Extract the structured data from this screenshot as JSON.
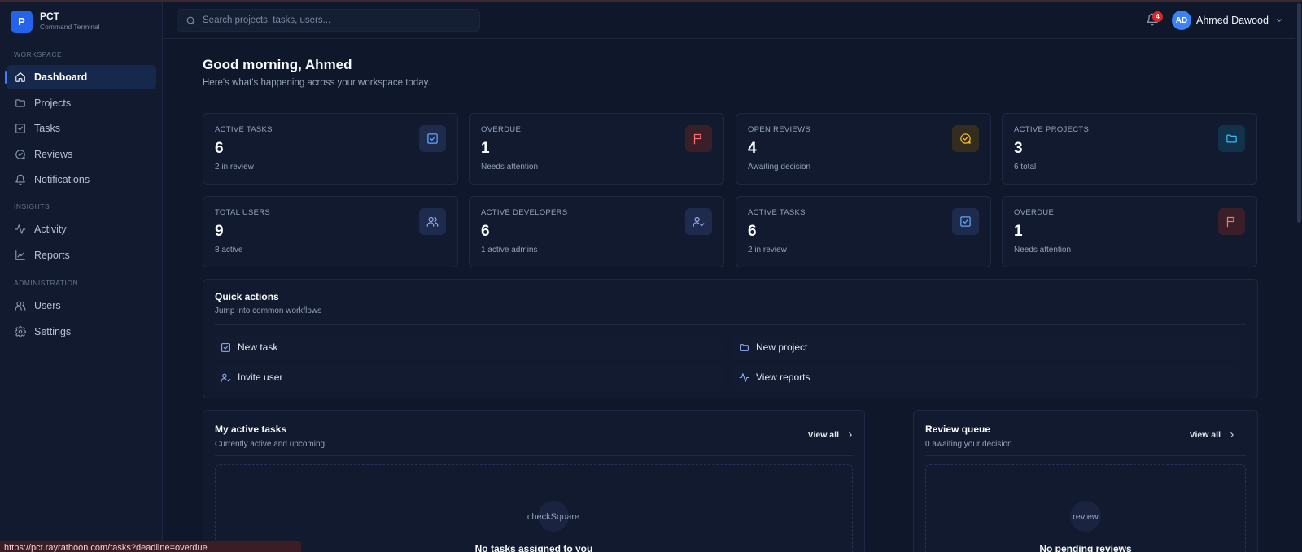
{
  "brand": {
    "logo_letter": "P",
    "name": "PCT",
    "subtitle": "Command Terminal"
  },
  "sidebar": {
    "sections": [
      {
        "title": "WORKSPACE",
        "items": [
          {
            "label": "Dashboard",
            "icon": "home-icon",
            "active": true
          },
          {
            "label": "Projects",
            "icon": "folder-icon"
          },
          {
            "label": "Tasks",
            "icon": "check-square-icon"
          },
          {
            "label": "Reviews",
            "icon": "message-circle-icon"
          },
          {
            "label": "Notifications",
            "icon": "bell-icon"
          }
        ]
      },
      {
        "title": "INSIGHTS",
        "items": [
          {
            "label": "Activity",
            "icon": "activity-icon"
          },
          {
            "label": "Reports",
            "icon": "line-chart-icon"
          }
        ]
      },
      {
        "title": "ADMINISTRATION",
        "items": [
          {
            "label": "Users",
            "icon": "users-icon"
          },
          {
            "label": "Settings",
            "icon": "gear-icon"
          }
        ]
      }
    ]
  },
  "header": {
    "search_placeholder": "Search projects, tasks, users...",
    "notification_count": "4",
    "user": {
      "initials": "AD",
      "name": "Ahmed Dawood"
    }
  },
  "main": {
    "greeting": "Good morning, Ahmed",
    "greeting_sub": "Here's what's happening across your workspace today.",
    "stats": [
      {
        "label": "ACTIVE TASKS",
        "value": "6",
        "sub": "2 in review",
        "icon": "check-square-icon",
        "color": "#60a5fa",
        "bg": "#1e2b4d"
      },
      {
        "label": "OVERDUE",
        "value": "1",
        "sub": "Needs attention",
        "icon": "flag-icon",
        "color": "#f87171",
        "bg": "#3a1e28"
      },
      {
        "label": "OPEN REVIEWS",
        "value": "4",
        "sub": "Awaiting decision",
        "icon": "message-circle-icon",
        "color": "#fbbf24",
        "bg": "#332c1f"
      },
      {
        "label": "ACTIVE PROJECTS",
        "value": "3",
        "sub": "6 total",
        "icon": "folder-icon",
        "color": "#38bdf8",
        "bg": "#12314a"
      },
      {
        "label": "TOTAL USERS",
        "value": "9",
        "sub": "8 active",
        "icon": "users-icon",
        "color": "#93a8e8",
        "bg": "#1e2b4d"
      },
      {
        "label": "ACTIVE DEVELOPERS",
        "value": "6",
        "sub": "1 active admins",
        "icon": "user-check-icon",
        "color": "#93a8e8",
        "bg": "#1e2b4d"
      },
      {
        "label": "ACTIVE TASKS",
        "value": "6",
        "sub": "2 in review",
        "icon": "check-square-icon",
        "color": "#60a5fa",
        "bg": "#1e2b4d"
      },
      {
        "label": "OVERDUE",
        "value": "1",
        "sub": "Needs attention",
        "icon": "flag-icon",
        "color": "#f87171",
        "bg": "#3a1e28"
      }
    ],
    "quick_actions": {
      "title": "Quick actions",
      "subtitle": "Jump into common workflows",
      "items": [
        {
          "label": "New task",
          "icon": "check-square-icon"
        },
        {
          "label": "New project",
          "icon": "folder-icon"
        },
        {
          "label": "Invite user",
          "icon": "user-check-icon"
        },
        {
          "label": "View reports",
          "icon": "activity-icon"
        }
      ]
    },
    "my_tasks": {
      "title": "My active tasks",
      "subtitle": "Currently active and upcoming",
      "view_all": "View all",
      "empty_icon_text": "checkSquare",
      "empty_title": "No tasks assigned to you"
    },
    "review_queue": {
      "title": "Review queue",
      "subtitle": "0 awaiting your decision",
      "view_all": "View all",
      "empty_icon_text": "review",
      "empty_title": "No pending reviews"
    }
  },
  "status_bar_url": "https://pct.rayrathoon.com/tasks?deadline=overdue"
}
